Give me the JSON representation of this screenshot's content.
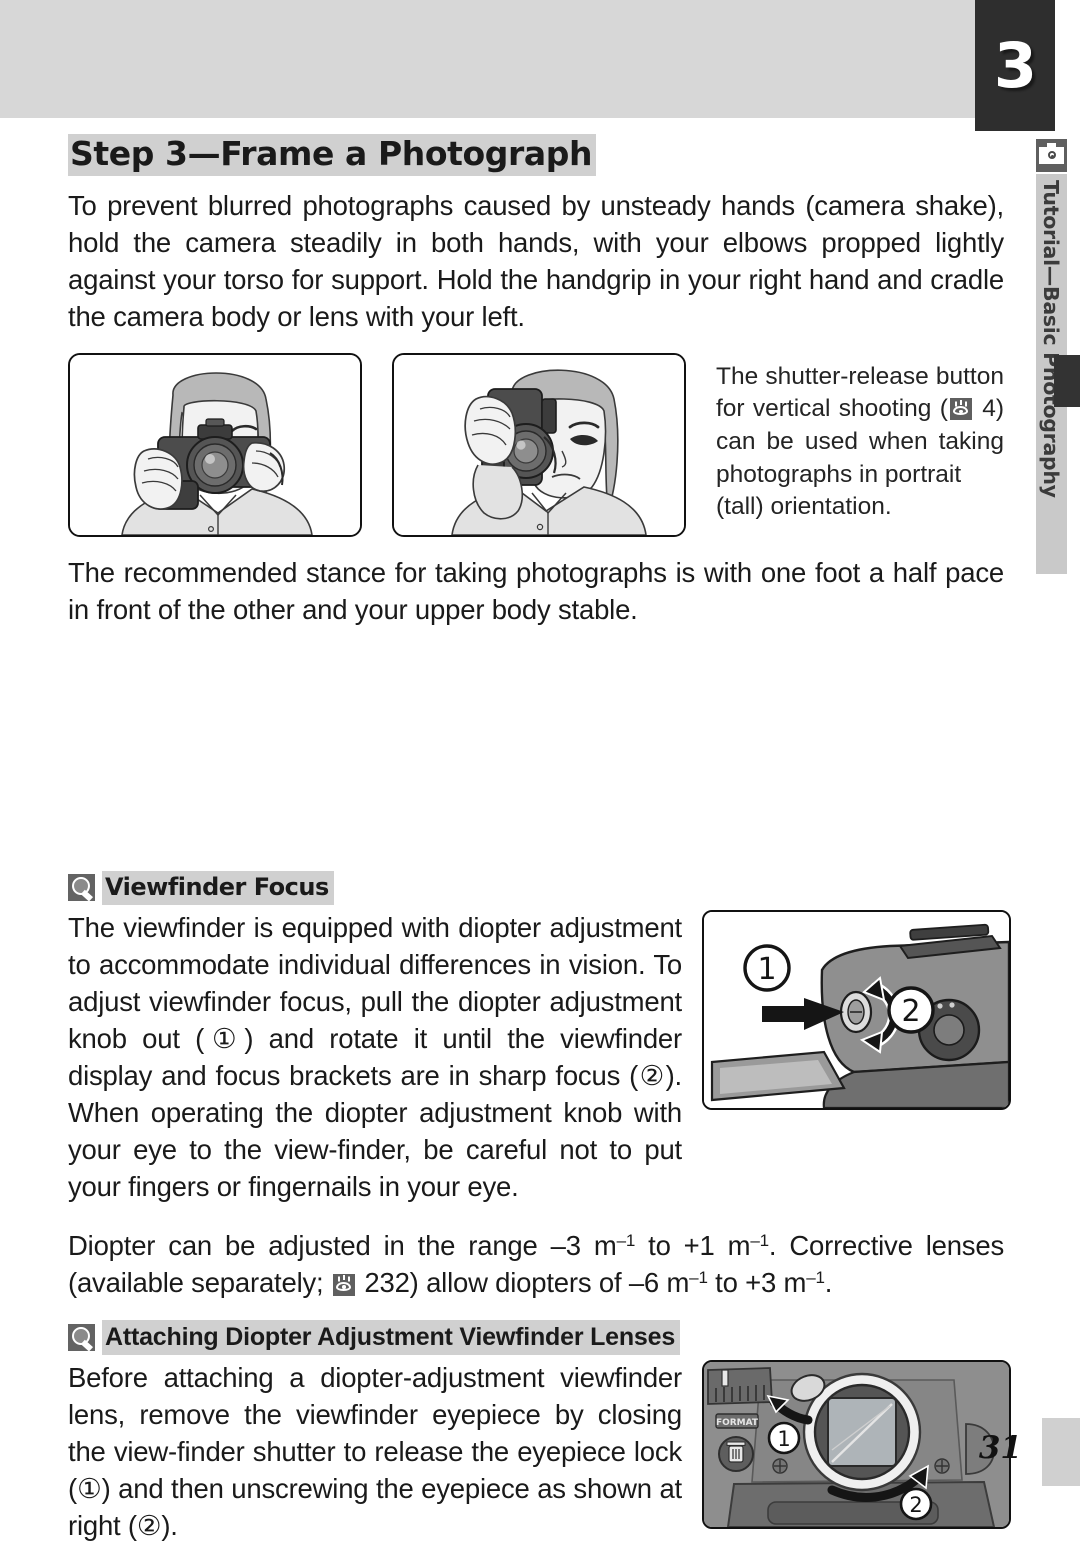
{
  "chapter": {
    "number": "3"
  },
  "sidebar": {
    "label": "Tutorial—Basic Photography",
    "icon": "camera-person-icon"
  },
  "header": {
    "title": "Step 3—Frame a Photograph"
  },
  "intro": {
    "paragraph": "To prevent blurred photographs caused by unsteady hands (camera shake), hold the camera steadily in both hands, with your elbows propped lightly against your torso for support.  Hold the handgrip in your right hand and cradle the camera body or lens with your left."
  },
  "illustrations": {
    "horizontal": {
      "caption": "person-holding-camera-horizontal"
    },
    "vertical": {
      "caption": "person-holding-camera-vertical"
    }
  },
  "callout": {
    "line1": "The shutter-release button",
    "line2_pre": "for vertical shooting (",
    "icon": "eye-reference-icon",
    "line2_post": " 4)",
    "line3": "can be used when taking photographs in portrait",
    "line4": "(tall) orientation."
  },
  "stance": {
    "paragraph": "The recommended stance for taking photographs is with one foot a half pace in front of the other and your upper body stable."
  },
  "viewfinder_focus": {
    "icon": "magnifier-icon",
    "heading": "Viewfinder Focus",
    "paragraph": "The viewfinder is equipped with diopter adjustment to accommodate individual differences in vision.  To adjust viewfinder focus, pull the diopter adjustment knob out (①) and rotate it until the viewfinder display and focus brackets are in sharp focus (②).  When operating the diopter adjustment knob with your eye to the view-finder, be careful not to put your fingers or fingernails in your eye.",
    "figure": {
      "caption": "camera-top-diopter-knob",
      "marker1": "①",
      "marker2": "②"
    }
  },
  "diopter_range": {
    "pre": "Diopter can be adjusted in the range –3 m",
    "sup1": "–1",
    "mid1": " to +1 m",
    "sup2": "–1",
    "mid2": ".  Corrective lenses (available separately; ",
    "icon": "eye-reference-icon",
    "page_ref": "232",
    "mid3": ") allow diopters of –6 m",
    "sup3": "–1",
    "mid4": " to +3 m",
    "sup4": "–1",
    "end": "."
  },
  "attaching_lenses": {
    "icon": "magnifier-icon",
    "heading": "Attaching Diopter Adjustment Viewfinder Lenses",
    "paragraph": "Before attaching a diopter-adjustment viewfinder lens, remove the viewfinder eyepiece by closing the view-finder shutter to release the eyepiece lock (①) and then unscrewing the eyepiece as shown at right (②).",
    "figure": {
      "caption": "camera-back-eyepiece",
      "marker1": "①",
      "marker2": "②",
      "format_label": "FORMAT",
      "trash_icon": "trash-icon"
    }
  },
  "footer": {
    "page_number": "31"
  },
  "colors": {
    "banner": "#d7d7d7",
    "chapter_box": "#2e2e2e",
    "highlight": "#d0d0d0",
    "tab": "#c9c9c9",
    "marker": "#333333",
    "icon_dark": "#5f5f5f"
  }
}
